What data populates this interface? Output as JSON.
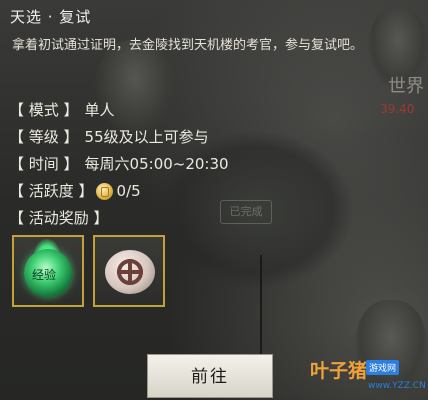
{
  "panel": {
    "title": "天选 · 复试",
    "description": "拿着初试通过证明，去金陵找到天机楼的考官，参与复试吧。"
  },
  "info": {
    "mode_label": "【 模式 】",
    "mode_value": "单人",
    "level_label": "【 等级 】",
    "level_value": "55级及以上可参与",
    "time_label": "【 时间 】",
    "time_value": "每周六05:00~20:30",
    "activity_label": "【 活跃度 】",
    "activity_value": "0/5",
    "rewards_label": "【 活动奖励 】"
  },
  "rewards": [
    {
      "name": "experience-orb",
      "text": "经验"
    },
    {
      "name": "silver-token",
      "text": ""
    }
  ],
  "buttons": {
    "go_label": "前往"
  },
  "background": {
    "stamp_text": "已完成",
    "world_text": "世界",
    "red_number": "39.40"
  },
  "watermark": {
    "brand": "叶子猪",
    "tag": "游戏网",
    "url": "www.YZZ.CN"
  },
  "colors": {
    "reward_border": "#c2a13d",
    "text": "#ece9df",
    "watermark_orange": "#f0a23a",
    "watermark_blue": "#2a7fe0"
  }
}
